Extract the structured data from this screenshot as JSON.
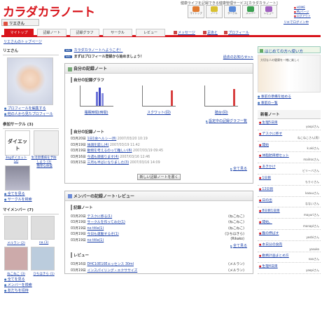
{
  "header": {
    "logo": "カラダカラノート",
    "tagline": "健康ライフを記録できる健康管理サービス[カラダカラノート]",
    "icons": [
      {
        "label": "マイトップ",
        "color": "#e07a30"
      },
      {
        "label": "ノート",
        "color": "#d8c030"
      },
      {
        "label": "サークル",
        "color": "#5a8ad8"
      },
      {
        "label": "メンバー",
        "color": "#3aa050"
      },
      {
        "label": "レビュー",
        "color": "#a060c0"
      }
    ],
    "links": [
      "HOME",
      "Myページ",
      "ログアウト"
    ],
    "user": "リエさん",
    "relogin": "リエでログイン中"
  },
  "nav": {
    "tabs": [
      "マイトップ",
      "記録ノート",
      "記録グラフ",
      "サークル",
      "レビュー"
    ],
    "sublinks": [
      "メッセージ",
      "足あと",
      "プロフィール"
    ]
  },
  "breadcrumb": "リエさんのトップページ",
  "left": {
    "user_title": "リエさん",
    "profile_links": [
      "プロフィールを編集する",
      "他の人から見たプロフィール"
    ],
    "circle_title": "参加サークル (3)",
    "circles": [
      {
        "name": "3kgダイエット",
        "count": "(2)",
        "icon": "ダイエット"
      },
      {
        "name": "生活習慣病を予防しよう",
        "count": "(3)",
        "icon": ""
      }
    ],
    "circle3": "簡単な体操",
    "circle_links": [
      "全てを見る",
      "サークルを検索"
    ],
    "member_title": "マイメンバー (7)",
    "members": [
      {
        "name": "メルラン",
        "count": "(2)"
      },
      {
        "name": "na",
        "count": "(1)"
      },
      {
        "name": "ねこねこ",
        "count": "(3)"
      },
      {
        "name": "ひちほきら",
        "count": "(1)"
      }
    ],
    "member_links": [
      "全てを見る",
      "メンバーを検索",
      "友だちを招待"
    ]
  },
  "main": {
    "info": [
      {
        "badge": "info",
        "text": "カラダカラノートへようこそ！"
      },
      {
        "badge": "info",
        "text": "まずはプロフィール登録から始めましょう！"
      }
    ],
    "past_notice": "過去のお知らせ>>",
    "panel1_title": "自分の記録ノート",
    "graph_section": "自分の記録グラフ",
    "graphs": [
      {
        "label": "睡眠時間(時間)"
      },
      {
        "label": "スクワット(回)"
      },
      {
        "label": "踏台(回)"
      }
    ],
    "graph_settings": "設定中の記録グラフ一覧",
    "note_section": "自分の記録ノート",
    "notes": [
      {
        "date": "03月20日",
        "title": "1日1食ヘルシー(8)",
        "time": "2007/03/20 10:19"
      },
      {
        "date": "03月19日",
        "title": "体調を崩し(4)",
        "time": "2007/03/19 11:42"
      },
      {
        "date": "03月19日",
        "title": "動物を考えるのって難しい(6)",
        "time": "2007/03/19 09:45"
      },
      {
        "date": "03月16日",
        "title": "今週も頑張ります(4)",
        "time": "2007/03/16 12:46"
      },
      {
        "date": "03月15日",
        "title": "三月も半ばになりました(3)",
        "time": "2007/03/16 14:09"
      }
    ],
    "new_note_btn": "新しい記録ノートを書く",
    "more": "全て見る",
    "panel2_title": "メンバーの記録ノート･レビュー",
    "member_note_section": "記録ノート",
    "member_notes": [
      {
        "date": "03月20日",
        "title": "テスクに移る(1)",
        "user": "(ねこねこ)"
      },
      {
        "date": "03月19日",
        "title": "サークルを作ってみた(1)",
        "user": "(ねこねこ)"
      },
      {
        "date": "03月19日",
        "title": "no title(1)",
        "user": "(ねこねこ)"
      },
      {
        "date": "03月19日",
        "title": "今日も運動するぞ(1)",
        "user": "(ひちほきら)"
      },
      {
        "date": "03月19日",
        "title": "no title(1)",
        "user": "(Rikako)"
      }
    ],
    "review_section": "レビュー",
    "reviews": [
      {
        "date": "03月16日",
        "title": "DHC10E10Eエッセンス 30ml",
        "user": "(メルラン)"
      },
      {
        "date": "03月19日",
        "title": "インスパイリング・エクササイズ",
        "user": "(メルラン)"
      }
    ]
  },
  "right": {
    "banner": "はじめての方へ使い方",
    "ad_text": "大切な人の健康を一緒に楽しく",
    "links": [
      "事前の準備を始める",
      "事前の一覧"
    ],
    "notes_title": "新着ノート",
    "notes": [
      {
        "title": "生理5日目",
        "author": "yoopiさん"
      },
      {
        "title": "デスクに移す",
        "author": "ねこねこさん(男)"
      },
      {
        "title": "開始",
        "author": "k.akiさん"
      },
      {
        "title": "体脂肪目標セット",
        "author": "mailrosさん"
      },
      {
        "title": "あきかけ",
        "author": "ビリーバさん"
      },
      {
        "title": "1日目",
        "author": "もりぐさん"
      },
      {
        "title": "12日目",
        "author": "kazuuさん"
      },
      {
        "title": "日の出",
        "author": "なないさん"
      },
      {
        "title": "8日目1日目",
        "author": "mayuriさん"
      },
      {
        "title": "開始。",
        "author": "manaplさん"
      },
      {
        "title": "腹の伸ばす",
        "author": "yosbiさん"
      },
      {
        "title": "本日分の食肉",
        "author": "yasuko"
      },
      {
        "title": "勤務計画まとめ方",
        "author": "naaさん"
      },
      {
        "title": "生理4日目",
        "author": "yoopiさん"
      }
    ]
  }
}
